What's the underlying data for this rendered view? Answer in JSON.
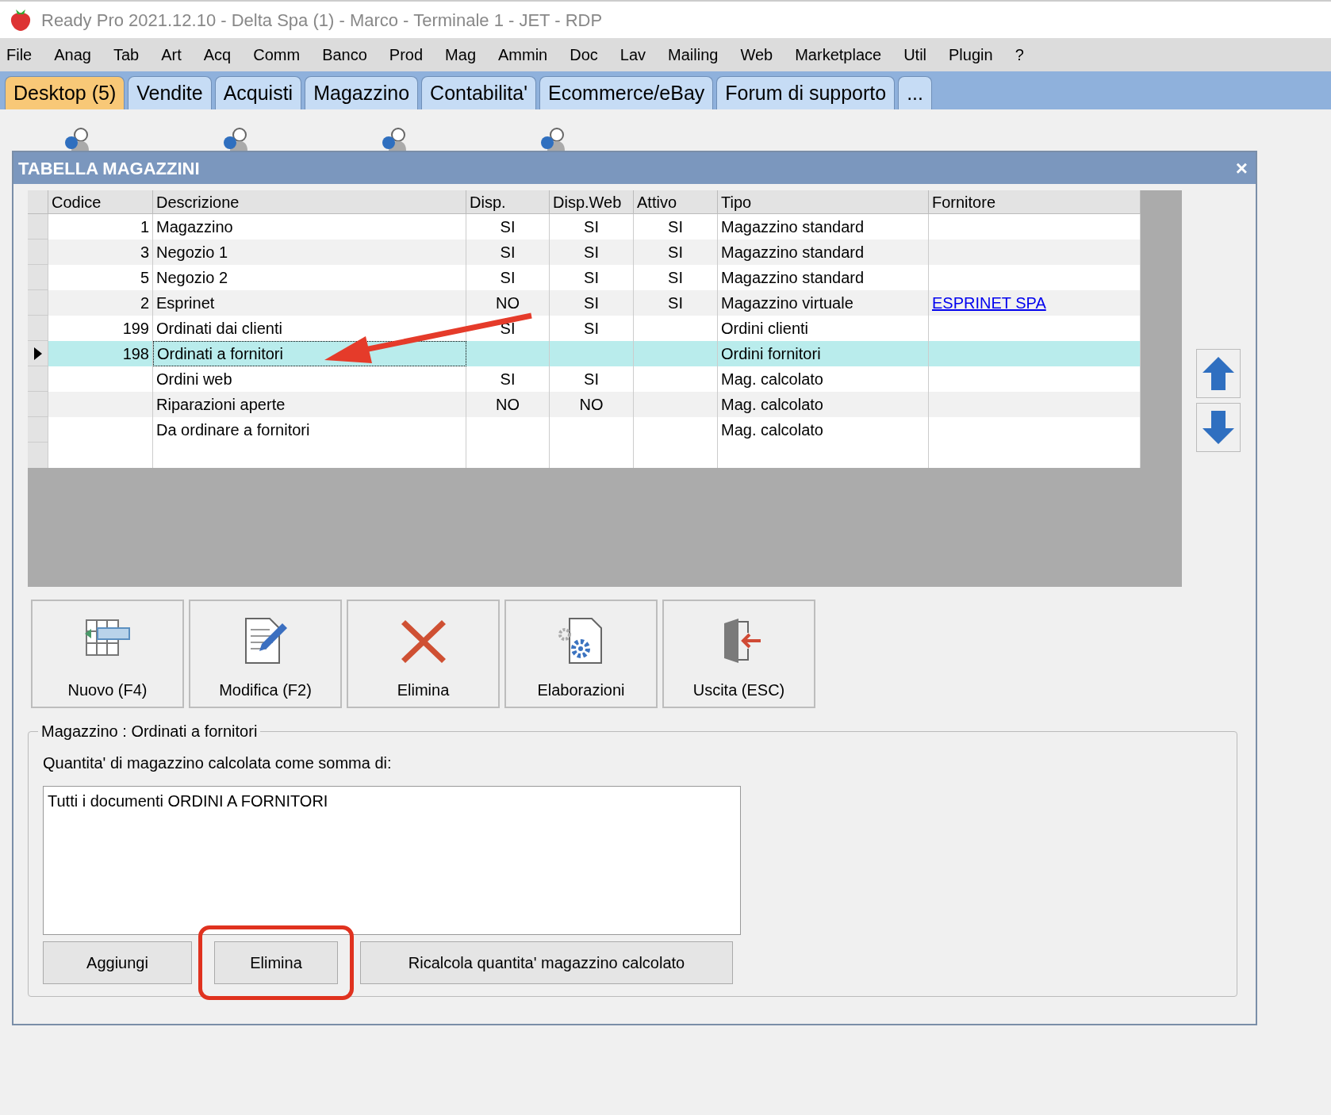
{
  "window": {
    "title": "Ready Pro 2021.12.10 - Delta Spa (1) - Marco - Terminale 1 - JET - RDP"
  },
  "menu": [
    "File",
    "Anag",
    "Tab",
    "Art",
    "Acq",
    "Comm",
    "Banco",
    "Prod",
    "Mag",
    "Ammin",
    "Doc",
    "Lav",
    "Mailing",
    "Web",
    "Marketplace",
    "Util",
    "Plugin",
    "?"
  ],
  "tabs": [
    {
      "label": "Desktop (5)",
      "selected": true
    },
    {
      "label": "Vendite",
      "selected": false
    },
    {
      "label": "Acquisti",
      "selected": false
    },
    {
      "label": "Magazzino",
      "selected": false
    },
    {
      "label": "Contabilita'",
      "selected": false
    },
    {
      "label": "Ecommerce/eBay",
      "selected": false
    },
    {
      "label": "Forum di supporto",
      "selected": false
    },
    {
      "label": "...",
      "selected": false
    }
  ],
  "dialog": {
    "title": "TABELLA MAGAZZINI",
    "close": "×",
    "table": {
      "columns": [
        "Codice",
        "Descrizione",
        "Disp.",
        "Disp.Web",
        "Attivo",
        "Tipo",
        "Fornitore"
      ],
      "rows": [
        {
          "codice": "1",
          "descrizione": "Magazzino",
          "disp": "SI",
          "disp_web": "SI",
          "attivo": "SI",
          "tipo": "Magazzino standard",
          "fornitore": "",
          "selected": false
        },
        {
          "codice": "3",
          "descrizione": "Negozio 1",
          "disp": "SI",
          "disp_web": "SI",
          "attivo": "SI",
          "tipo": "Magazzino standard",
          "fornitore": "",
          "selected": false
        },
        {
          "codice": "5",
          "descrizione": "Negozio 2",
          "disp": "SI",
          "disp_web": "SI",
          "attivo": "SI",
          "tipo": "Magazzino standard",
          "fornitore": "",
          "selected": false
        },
        {
          "codice": "2",
          "descrizione": "Esprinet",
          "disp": "NO",
          "disp_web": "SI",
          "attivo": "SI",
          "tipo": "Magazzino virtuale",
          "fornitore": "ESPRINET SPA",
          "selected": false
        },
        {
          "codice": "199",
          "descrizione": "Ordinati dai clienti",
          "disp": "SI",
          "disp_web": "SI",
          "attivo": "",
          "tipo": "Ordini clienti",
          "fornitore": "",
          "selected": false
        },
        {
          "codice": "198",
          "descrizione": "Ordinati a fornitori",
          "disp": "",
          "disp_web": "",
          "attivo": "",
          "tipo": "Ordini fornitori",
          "fornitore": "",
          "selected": true
        },
        {
          "codice": "",
          "descrizione": "Ordini web",
          "disp": "SI",
          "disp_web": "SI",
          "attivo": "",
          "tipo": "Mag. calcolato",
          "fornitore": "",
          "selected": false
        },
        {
          "codice": "",
          "descrizione": "Riparazioni aperte",
          "disp": "NO",
          "disp_web": "NO",
          "attivo": "",
          "tipo": "Mag. calcolato",
          "fornitore": "",
          "selected": false
        },
        {
          "codice": "",
          "descrizione": "Da ordinare a fornitori",
          "disp": "",
          "disp_web": "",
          "attivo": "",
          "tipo": "Mag. calcolato",
          "fornitore": "",
          "selected": false
        }
      ]
    },
    "toolbar": [
      {
        "kind": "new",
        "label": "Nuovo (F4)"
      },
      {
        "kind": "edit",
        "label": "Modifica (F2)"
      },
      {
        "kind": "delete",
        "label": "Elimina"
      },
      {
        "kind": "process",
        "label": "Elaborazioni"
      },
      {
        "kind": "exit",
        "label": "Uscita (ESC)"
      }
    ],
    "group": {
      "legend": "Magazzino : Ordinati a fornitori",
      "label": "Quantita' di magazzino calcolata come somma di:",
      "value": "Tutti i documenti ORDINI A FORNITORI",
      "buttons": [
        {
          "label": "Aggiungi",
          "highlighted": false
        },
        {
          "label": "Elimina",
          "highlighted": true
        },
        {
          "label": "Ricalcola quantita' magazzino calcolato",
          "highlighted": false
        }
      ]
    }
  }
}
